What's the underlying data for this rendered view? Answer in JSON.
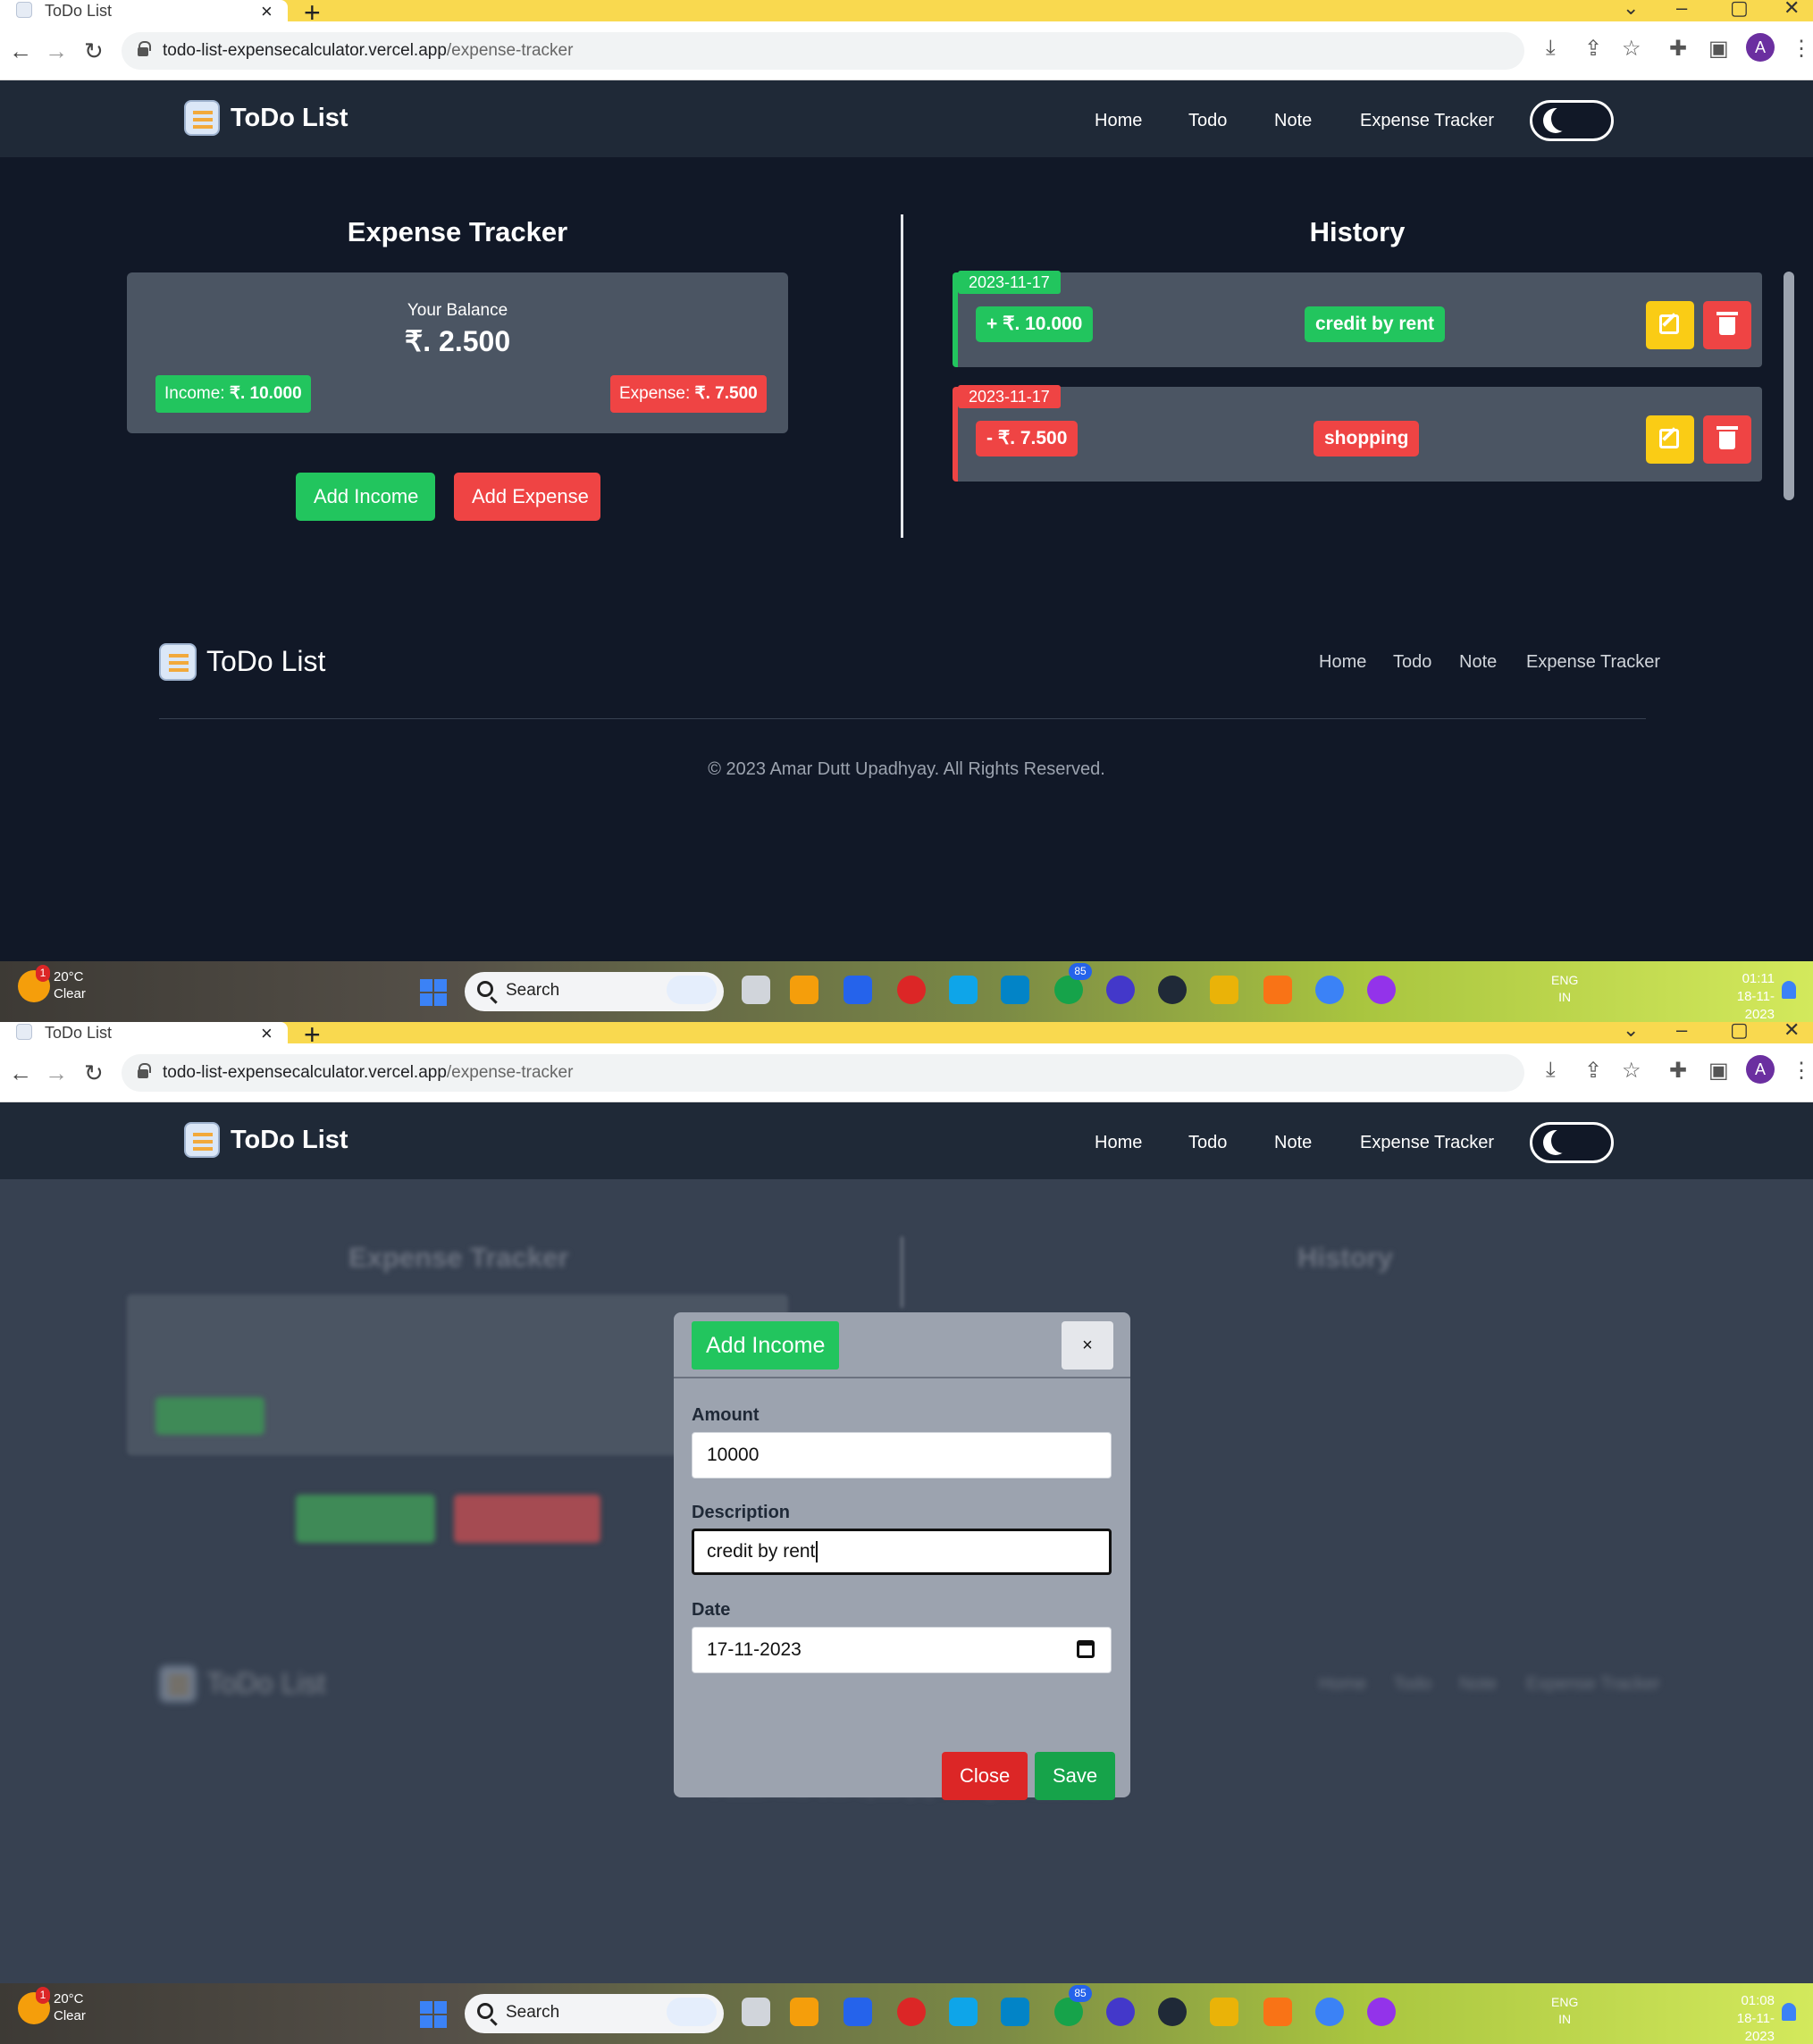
{
  "browser": {
    "tab_title": "ToDo List",
    "tab_close": "×",
    "new_tab": "+",
    "url_domain": "todo-list-expensecalculator.vercel.app",
    "url_path": "/expense-tracker",
    "avatar_letter": "A"
  },
  "navbar": {
    "brand": "ToDo List",
    "links": [
      "Home",
      "Todo",
      "Note",
      "Expense Tracker"
    ]
  },
  "expense_tracker": {
    "title": "Expense Tracker",
    "balance_label": "Your Balance",
    "balance_value": "₹. 2.500",
    "income_label": "Income:",
    "income_value": "₹. 10.000",
    "expense_label": "Expense:",
    "expense_value": "₹. 7.500",
    "add_income_button": "Add Income",
    "add_expense_button": "Add Expense"
  },
  "history": {
    "title": "History",
    "items": [
      {
        "date": "2023-11-17",
        "amount": "+ ₹. 10.000",
        "description": "credit by rent",
        "type": "income"
      },
      {
        "date": "2023-11-17",
        "amount": "- ₹. 7.500",
        "description": "shopping",
        "type": "expense"
      }
    ]
  },
  "footer": {
    "brand": "ToDo List",
    "links": [
      "Home",
      "Todo",
      "Note",
      "Expense Tracker"
    ],
    "copyright": "© 2023 Amar Dutt Upadhyay. All Rights Reserved."
  },
  "taskbar": {
    "temperature": "20°C",
    "weather": "Clear",
    "search_label": "Search",
    "language": "ENG",
    "region": "IN",
    "time_1": "01:11",
    "time_2": "01:08",
    "date": "18-11-2023",
    "weather_badge": "1",
    "whatsapp_badge": "85"
  },
  "modal": {
    "title": "Add Income",
    "close_x": "×",
    "amount_label": "Amount",
    "amount_value": "10000",
    "description_label": "Description",
    "description_value": "credit by rent",
    "date_label": "Date",
    "date_value": "17-11-2023",
    "close_button": "Close",
    "save_button": "Save"
  },
  "colors": {
    "page_bg": "#111827",
    "navbar_bg": "#1f2937",
    "card_bg": "#4b5563",
    "income": "#22c55e",
    "expense": "#ef4444",
    "edit": "#facc15",
    "browser_tabbar": "#f9d94f"
  },
  "icons": [
    "tab-favicon-icon",
    "close-icon",
    "plus-icon",
    "back-icon",
    "forward-icon",
    "reload-icon",
    "lock-icon",
    "download-icon",
    "share-icon",
    "star-icon",
    "extensions-icon",
    "sidepanel-icon",
    "menu-icon",
    "app-logo-icon",
    "moon-icon",
    "edit-icon",
    "trash-icon",
    "search-icon",
    "calendar-icon",
    "windows-start-icon"
  ]
}
